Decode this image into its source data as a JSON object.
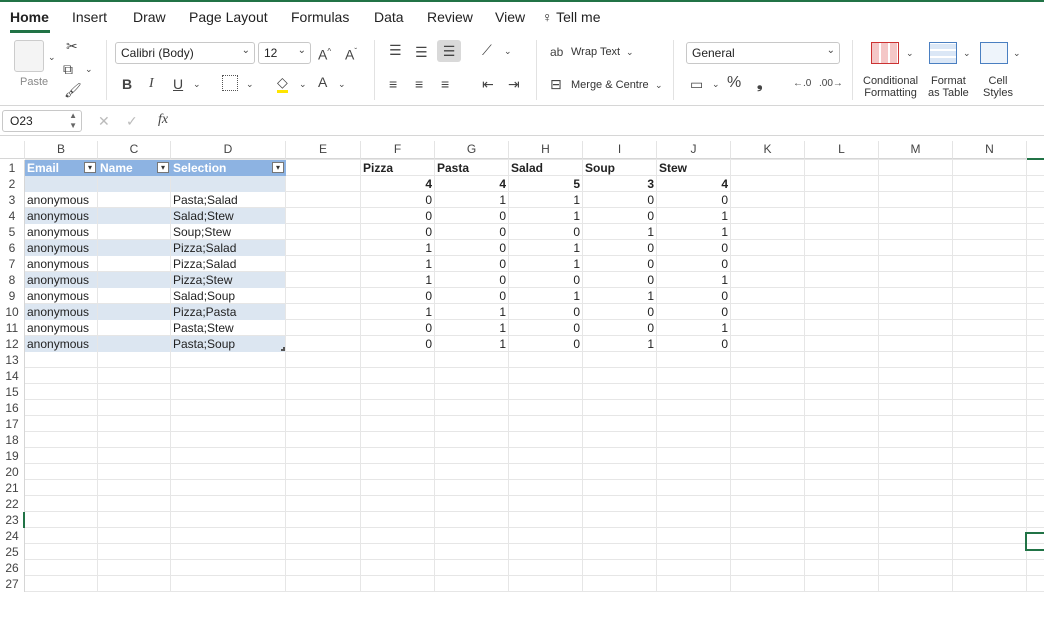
{
  "tabs": [
    "Home",
    "Insert",
    "Draw",
    "Page Layout",
    "Formulas",
    "Data",
    "Review",
    "View",
    "Tell me"
  ],
  "ribbon": {
    "paste_label": "Paste",
    "font_name": "Calibri (Body)",
    "font_size": "12",
    "wrap_text": "Wrap Text",
    "merge_centre": "Merge & Centre",
    "number_format": "General",
    "conditional_formatting": [
      "Conditional",
      "Formatting"
    ],
    "format_as_table": [
      "Format",
      "as Table"
    ],
    "cell_styles": [
      "Cell",
      "Styles"
    ],
    "bold": "B",
    "italic": "I",
    "underline": "U",
    "grow_font": "A",
    "shrink_font": "A",
    "font_color": "A",
    "percent": "%",
    "comma": "❟",
    "fx": "fx"
  },
  "name_box": "O23",
  "columns": [
    "B",
    "C",
    "D",
    "E",
    "F",
    "G",
    "H",
    "I",
    "J",
    "K",
    "L",
    "M",
    "N"
  ],
  "rows": [
    "1",
    "2",
    "3",
    "4",
    "5",
    "6",
    "7",
    "8",
    "9",
    "10",
    "11",
    "12",
    "13",
    "14",
    "15",
    "16",
    "17",
    "18",
    "19",
    "20",
    "21",
    "22",
    "23",
    "24",
    "25",
    "26",
    "27"
  ],
  "table": {
    "headers": [
      "Email",
      "Name",
      "Selection"
    ],
    "rows": [
      {
        "email": "",
        "name": "",
        "selection": ""
      },
      {
        "email": "anonymous",
        "name": "",
        "selection": "Pasta;Salad"
      },
      {
        "email": "anonymous",
        "name": "",
        "selection": "Salad;Stew"
      },
      {
        "email": "anonymous",
        "name": "",
        "selection": "Soup;Stew"
      },
      {
        "email": "anonymous",
        "name": "",
        "selection": "Pizza;Salad"
      },
      {
        "email": "anonymous",
        "name": "",
        "selection": "Pizza;Salad"
      },
      {
        "email": "anonymous",
        "name": "",
        "selection": "Pizza;Stew"
      },
      {
        "email": "anonymous",
        "name": "",
        "selection": "Salad;Soup"
      },
      {
        "email": "anonymous",
        "name": "",
        "selection": "Pizza;Pasta"
      },
      {
        "email": "anonymous",
        "name": "",
        "selection": "Pasta;Stew"
      },
      {
        "email": "anonymous",
        "name": "",
        "selection": "Pasta;Soup"
      }
    ]
  },
  "matrix": {
    "headers": [
      "Pizza",
      "Pasta",
      "Salad",
      "Soup",
      "Stew"
    ],
    "totals": [
      "4",
      "4",
      "5",
      "3",
      "4"
    ],
    "rows": [
      [
        "0",
        "1",
        "1",
        "0",
        "0"
      ],
      [
        "0",
        "0",
        "1",
        "0",
        "1"
      ],
      [
        "0",
        "0",
        "0",
        "1",
        "1"
      ],
      [
        "1",
        "0",
        "1",
        "0",
        "0"
      ],
      [
        "1",
        "0",
        "1",
        "0",
        "0"
      ],
      [
        "1",
        "0",
        "0",
        "0",
        "1"
      ],
      [
        "0",
        "0",
        "1",
        "1",
        "0"
      ],
      [
        "1",
        "1",
        "0",
        "0",
        "0"
      ],
      [
        "0",
        "1",
        "0",
        "0",
        "1"
      ],
      [
        "0",
        "1",
        "0",
        "1",
        "0"
      ]
    ]
  },
  "colors": {
    "accent": "#217346",
    "table_header": "#8db3e2",
    "table_band": "#dce6f1"
  }
}
